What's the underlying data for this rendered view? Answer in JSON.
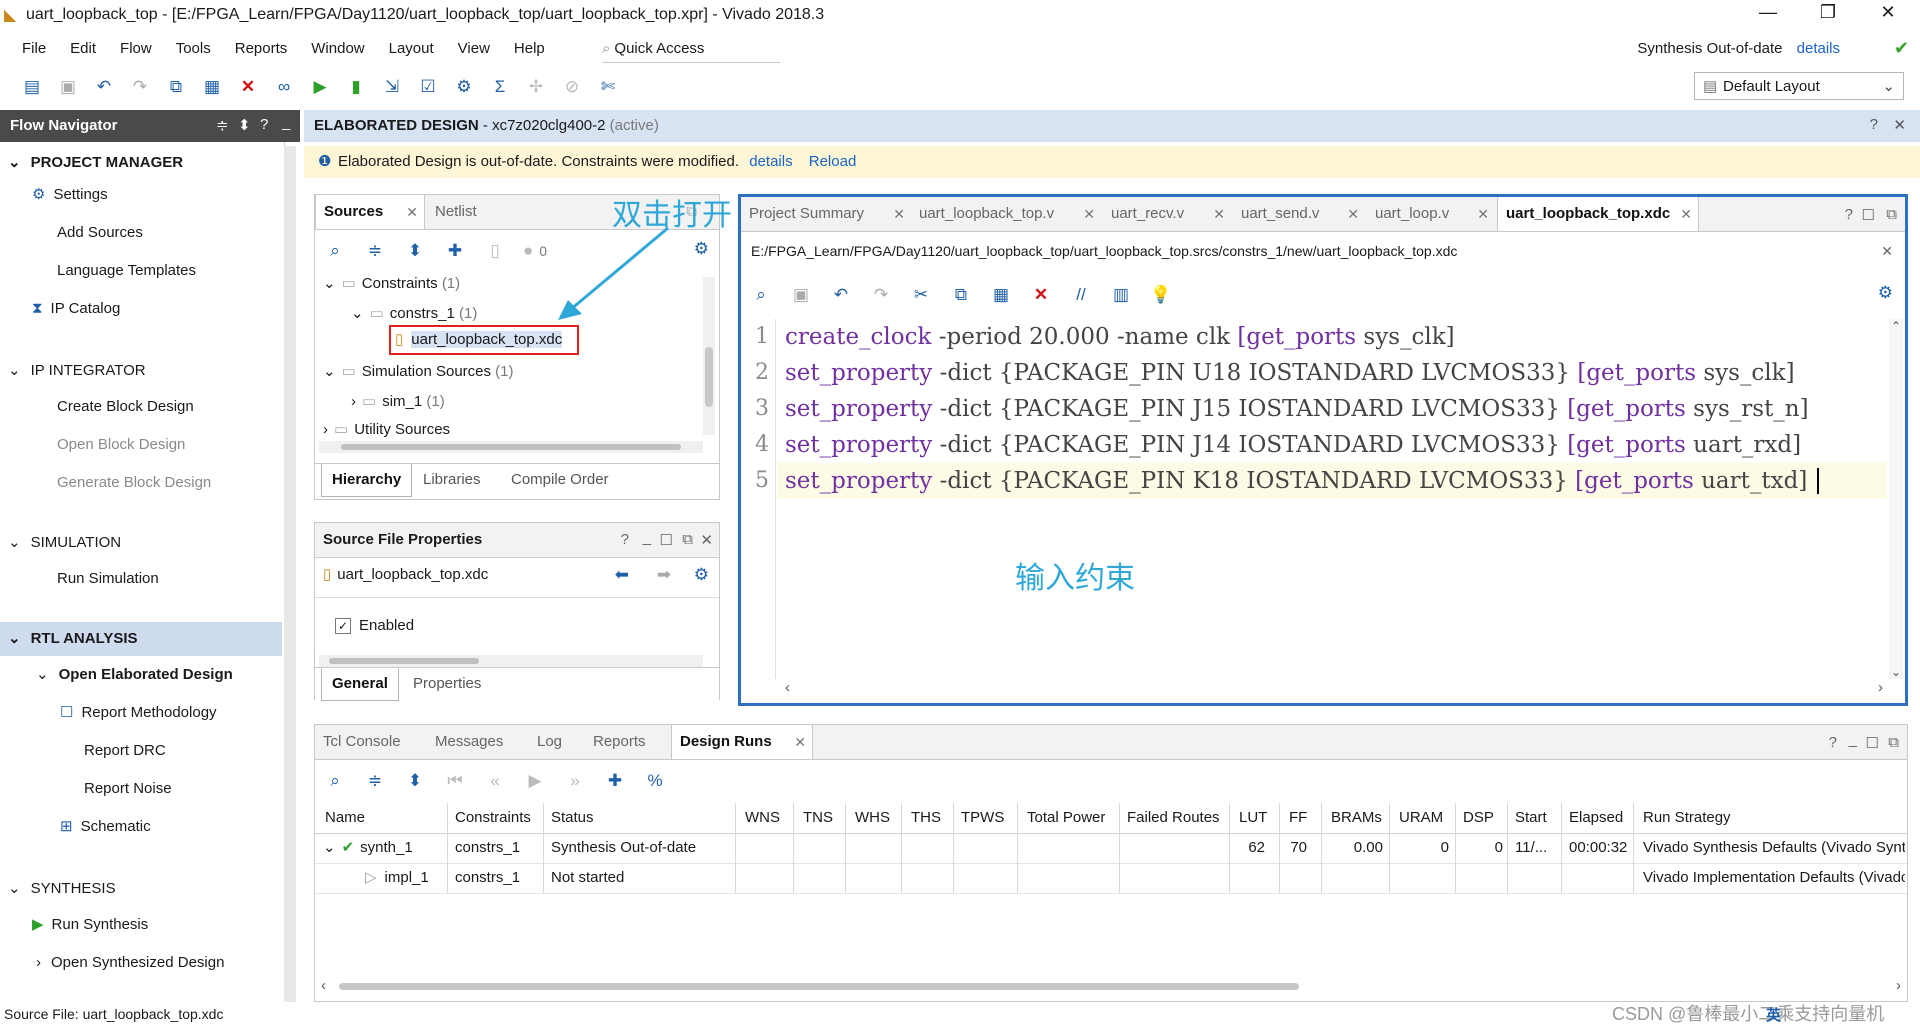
{
  "window": {
    "title": "uart_loopback_top - [E:/FPGA_Learn/FPGA/Day1120/uart_loopback_top/uart_loopback_top.xpr] - Vivado 2018.3",
    "minimize": "—",
    "maximize": "❐",
    "close": "✕"
  },
  "menu": [
    "File",
    "Edit",
    "Flow",
    "Tools",
    "Reports",
    "Window",
    "Layout",
    "View",
    "Help"
  ],
  "quick_access": "Quick Access",
  "synthesis_status": {
    "text": "Synthesis Out-of-date",
    "link": "details"
  },
  "layout_select": "Default Layout",
  "flow_navigator": {
    "title": "Flow Navigator",
    "sections": {
      "project_manager": "PROJECT MANAGER",
      "ip_integrator": "IP INTEGRATOR",
      "simulation": "SIMULATION",
      "rtl_analysis": "RTL ANALYSIS",
      "synthesis": "SYNTHESIS"
    },
    "items": {
      "settings": "Settings",
      "add_sources": "Add Sources",
      "language_templates": "Language Templates",
      "ip_catalog": "IP Catalog",
      "create_block_design": "Create Block Design",
      "open_block_design": "Open Block Design",
      "generate_block_design": "Generate Block Design",
      "run_simulation": "Run Simulation",
      "open_elaborated_design": "Open Elaborated Design",
      "report_methodology": "Report Methodology",
      "report_drc": "Report DRC",
      "report_noise": "Report Noise",
      "schematic": "Schematic",
      "run_synthesis": "Run Synthesis",
      "open_synthesized_design": "Open Synthesized Design"
    }
  },
  "main_header": {
    "title": "ELABORATED DESIGN",
    "part": " - xc7z020clg400-2",
    "status": " (active)"
  },
  "warning": {
    "text": "Elaborated Design is out-of-date. Constraints were modified.",
    "details": "details",
    "reload": "Reload"
  },
  "sources_panel": {
    "tabs": [
      "Sources",
      "Netlist"
    ],
    "badge_count": "0",
    "tree": {
      "constraints": "Constraints",
      "constraints_count": "(1)",
      "constrs_1": "constrs_1",
      "constrs_1_count": "(1)",
      "xdc_file": "uart_loopback_top.xdc",
      "simulation_sources": "Simulation Sources",
      "simulation_sources_count": "(1)",
      "sim_1": "sim_1",
      "sim_1_count": "(1)",
      "utility_sources": "Utility Sources"
    },
    "bottom_tabs": [
      "Hierarchy",
      "Libraries",
      "Compile Order"
    ]
  },
  "source_file_properties": {
    "title": "Source File Properties",
    "file": "uart_loopback_top.xdc",
    "enabled_label": "Enabled",
    "enabled": true,
    "bottom_tabs": [
      "General",
      "Properties"
    ]
  },
  "editor": {
    "tabs": [
      "Project Summary",
      "uart_loopback_top.v",
      "uart_recv.v",
      "uart_send.v",
      "uart_loop.v",
      "uart_loopback_top.xdc"
    ],
    "active_tab": 5,
    "path": "E:/FPGA_Learn/FPGA/Day1120/uart_loopback_top/uart_loopback_top.srcs/constrs_1/new/uart_loopback_top.xdc",
    "lines": [
      {
        "num": "1",
        "cmd": "create_clock",
        "args": " -period 20.000 -name clk ",
        "bracket": "[get_ports",
        "port": " sys_clk]"
      },
      {
        "num": "2",
        "cmd": "set_property",
        "args": " -dict {PACKAGE_PIN U18 IOSTANDARD LVCMOS33} ",
        "bracket": "[get_ports",
        "port": " sys_clk]"
      },
      {
        "num": "3",
        "cmd": "set_property",
        "args": " -dict {PACKAGE_PIN J15 IOSTANDARD LVCMOS33} ",
        "bracket": "[get_ports",
        "port": " sys_rst_n]"
      },
      {
        "num": "4",
        "cmd": "set_property",
        "args": " -dict {PACKAGE_PIN J14 IOSTANDARD LVCMOS33} ",
        "bracket": "[get_ports",
        "port": " uart_rxd]"
      },
      {
        "num": "5",
        "cmd": "set_property",
        "args": " -dict {PACKAGE_PIN K18 IOSTANDARD LVCMOS33} ",
        "bracket": "[get_ports",
        "port": " uart_txd]"
      }
    ]
  },
  "annotations": {
    "double_click": "双击打开",
    "input_constraints": "输入约束"
  },
  "console": {
    "tabs": [
      "Tcl Console",
      "Messages",
      "Log",
      "Reports",
      "Design Runs"
    ],
    "columns": [
      "Name",
      "Constraints",
      "Status",
      "WNS",
      "TNS",
      "WHS",
      "THS",
      "TPWS",
      "Total Power",
      "Failed Routes",
      "LUT",
      "FF",
      "BRAMs",
      "URAM",
      "DSP",
      "Start",
      "Elapsed",
      "Run Strategy"
    ],
    "rows": [
      {
        "name": "synth_1",
        "constraints": "constrs_1",
        "status": "Synthesis Out-of-date",
        "wns": "",
        "tns": "",
        "whs": "",
        "ths": "",
        "tpws": "",
        "power": "",
        "failed": "",
        "lut": "62",
        "ff": "70",
        "brams": "0.00",
        "uram": "0",
        "dsp": "0",
        "start": "11/...",
        "elapsed": "00:00:32",
        "strategy": "Vivado Synthesis Defaults (Vivado Synth"
      },
      {
        "name": "impl_1",
        "constraints": "constrs_1",
        "status": "Not started",
        "wns": "",
        "tns": "",
        "whs": "",
        "ths": "",
        "tpws": "",
        "power": "",
        "failed": "",
        "lut": "",
        "ff": "",
        "brams": "",
        "uram": "",
        "dsp": "",
        "start": "",
        "elapsed": "",
        "strategy": "Vivado Implementation Defaults (Vivado"
      }
    ]
  },
  "statusbar": {
    "text": "Source File: uart_loopback_top.xdc"
  },
  "watermark": "CSDN @鲁棒最小二乘支持向量机",
  "ime": "英"
}
